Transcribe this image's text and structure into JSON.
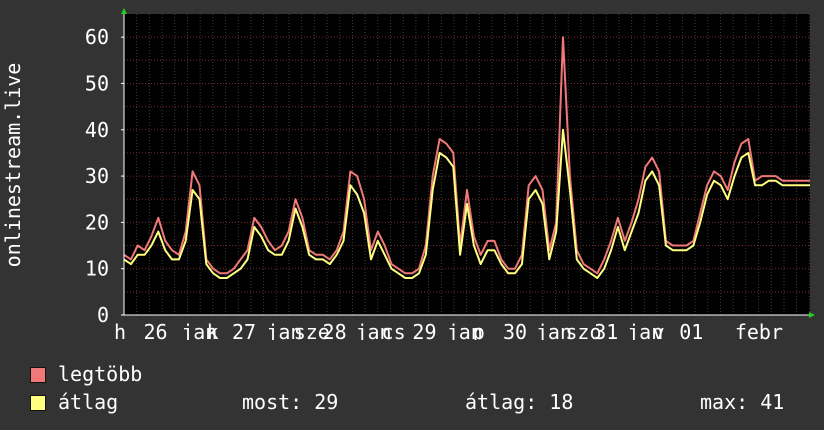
{
  "chart_data": {
    "type": "line",
    "ylabel": "onlinestream.live",
    "ylim": [
      0,
      65
    ],
    "yticks": [
      0,
      10,
      20,
      30,
      40,
      50,
      60
    ],
    "grid": true,
    "legend_position": "bottom",
    "x_range": [
      0,
      100
    ],
    "xticks": [
      {
        "label": "h",
        "x": 0
      },
      {
        "label": "26",
        "x": 4.3
      },
      {
        "label": "jan",
        "x": 9.8
      },
      {
        "label": "k",
        "x": 13.5
      },
      {
        "label": "27",
        "x": 17.2
      },
      {
        "label": "jan",
        "x": 22.2
      },
      {
        "label": "sze",
        "x": 26.2
      },
      {
        "label": "28",
        "x": 30.4
      },
      {
        "label": "jan",
        "x": 35.2
      },
      {
        "label": "cs",
        "x": 39.0
      },
      {
        "label": "29",
        "x": 43.5
      },
      {
        "label": "jan",
        "x": 48.5
      },
      {
        "label": "p",
        "x": 52.3
      },
      {
        "label": "30",
        "x": 56.7
      },
      {
        "label": "jan",
        "x": 61.5
      },
      {
        "label": "szo",
        "x": 65.8
      },
      {
        "label": "31",
        "x": 70.0
      },
      {
        "label": "jan",
        "x": 74.8
      },
      {
        "label": "v",
        "x": 78.5
      },
      {
        "label": "01",
        "x": 82.4
      },
      {
        "label": "febr",
        "x": 90.5
      }
    ],
    "series": [
      {
        "name": "legtöbb",
        "color": "#f07878",
        "x": [
          0,
          1,
          2,
          3,
          4,
          5,
          6,
          7,
          8,
          9,
          10,
          11,
          12,
          13,
          14,
          15,
          16,
          17,
          18,
          19,
          20,
          21,
          22,
          23,
          24,
          25,
          26,
          27,
          28,
          29,
          30,
          31,
          32,
          33,
          34,
          35,
          36,
          37,
          38,
          39,
          40,
          41,
          42,
          43,
          44,
          45,
          46,
          47,
          48,
          49,
          50,
          51,
          52,
          53,
          54,
          55,
          56,
          57,
          58,
          59,
          60,
          61,
          62,
          63,
          64,
          65,
          66,
          67,
          68,
          69,
          70,
          71,
          72,
          73,
          74,
          75,
          76,
          77,
          78,
          79,
          80,
          81,
          82,
          83,
          84,
          85,
          86,
          87,
          88,
          89,
          90,
          91,
          92,
          93,
          94,
          95,
          96,
          97,
          98,
          99,
          100
        ],
        "values": [
          13,
          12,
          15,
          14,
          17,
          21,
          16,
          14,
          13,
          18,
          31,
          28,
          12,
          10,
          9,
          9,
          10,
          12,
          14,
          21,
          19,
          16,
          14,
          15,
          18,
          25,
          21,
          14,
          13,
          13,
          12,
          14,
          18,
          31,
          30,
          25,
          14,
          18,
          15,
          11,
          10,
          9,
          9,
          10,
          15,
          30,
          38,
          37,
          35,
          15,
          27,
          17,
          13,
          16,
          16,
          12,
          10,
          10,
          13,
          28,
          30,
          27,
          14,
          20,
          60,
          30,
          14,
          11,
          10,
          9,
          12,
          16,
          21,
          16,
          20,
          25,
          32,
          34,
          31,
          16,
          15,
          15,
          15,
          16,
          22,
          28,
          31,
          30,
          27,
          33,
          37,
          38,
          29,
          30,
          30,
          30,
          29,
          29,
          29,
          29,
          29
        ]
      },
      {
        "name": "átlag",
        "color": "#ffff80",
        "x": [
          0,
          1,
          2,
          3,
          4,
          5,
          6,
          7,
          8,
          9,
          10,
          11,
          12,
          13,
          14,
          15,
          16,
          17,
          18,
          19,
          20,
          21,
          22,
          23,
          24,
          25,
          26,
          27,
          28,
          29,
          30,
          31,
          32,
          33,
          34,
          35,
          36,
          37,
          38,
          39,
          40,
          41,
          42,
          43,
          44,
          45,
          46,
          47,
          48,
          49,
          50,
          51,
          52,
          53,
          54,
          55,
          56,
          57,
          58,
          59,
          60,
          61,
          62,
          63,
          64,
          65,
          66,
          67,
          68,
          69,
          70,
          71,
          72,
          73,
          74,
          75,
          76,
          77,
          78,
          79,
          80,
          81,
          82,
          83,
          84,
          85,
          86,
          87,
          88,
          89,
          90,
          91,
          92,
          93,
          94,
          95,
          96,
          97,
          98,
          99,
          100
        ],
        "values": [
          12,
          11,
          13,
          13,
          15,
          18,
          14,
          12,
          12,
          16,
          27,
          25,
          11,
          9,
          8,
          8,
          9,
          10,
          12,
          19,
          17,
          14,
          13,
          13,
          16,
          23,
          19,
          13,
          12,
          12,
          11,
          13,
          16,
          28,
          26,
          22,
          12,
          16,
          13,
          10,
          9,
          8,
          8,
          9,
          13,
          27,
          35,
          34,
          32,
          13,
          24,
          15,
          11,
          14,
          14,
          11,
          9,
          9,
          11,
          25,
          27,
          24,
          12,
          18,
          40,
          27,
          12,
          10,
          9,
          8,
          10,
          14,
          19,
          14,
          18,
          22,
          29,
          31,
          28,
          15,
          14,
          14,
          14,
          15,
          20,
          26,
          29,
          28,
          25,
          30,
          34,
          35,
          28,
          28,
          29,
          29,
          28,
          28,
          28,
          28,
          28
        ]
      }
    ]
  },
  "legend": {
    "items": [
      {
        "label": "legtöbb",
        "color": "#f07878"
      },
      {
        "label": "átlag",
        "color": "#ffff80"
      }
    ],
    "now_label": "most:",
    "now_value": "29",
    "avg_label": "átlag:",
    "avg_value": "18",
    "max_label": "max:",
    "max_value": "41"
  }
}
